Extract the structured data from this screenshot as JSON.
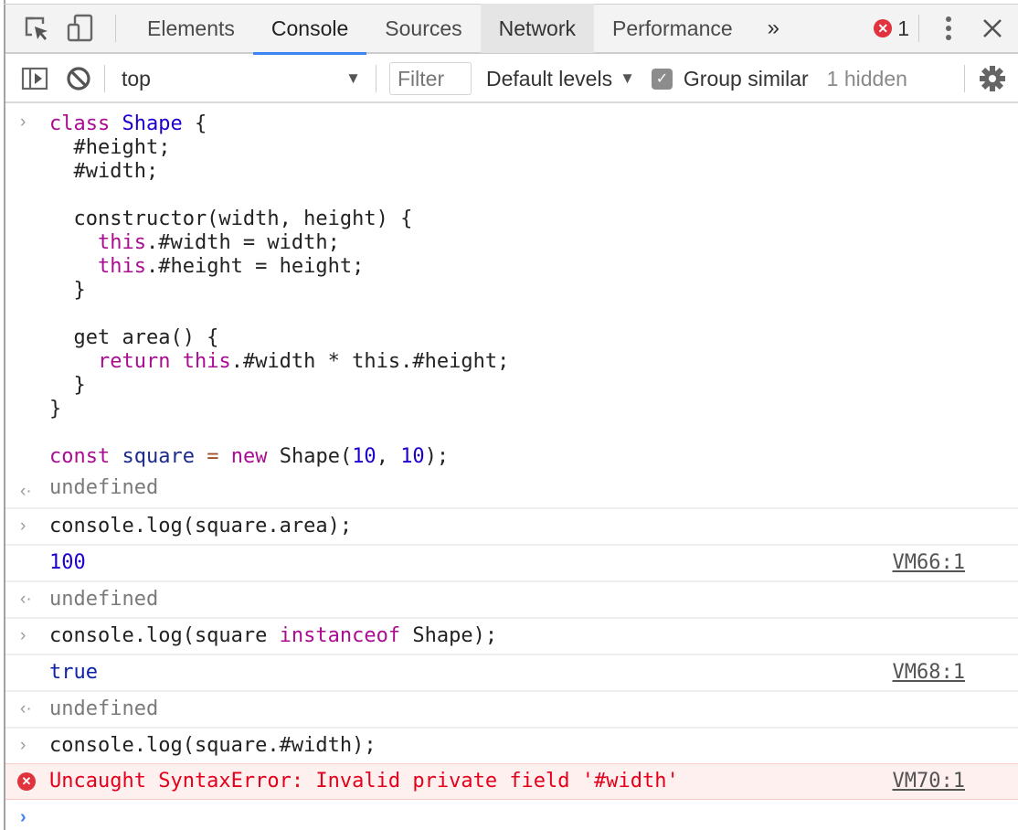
{
  "tabbar": {
    "icons": [
      "inspect-element-icon",
      "device-toolbar-icon"
    ],
    "tabs": [
      {
        "label": "Elements",
        "state": "inactive"
      },
      {
        "label": "Console",
        "state": "active"
      },
      {
        "label": "Sources",
        "state": "inactive"
      },
      {
        "label": "Network",
        "state": "hover"
      },
      {
        "label": "Performance",
        "state": "inactive"
      }
    ],
    "more_tabs": "»",
    "error_count": "1",
    "accent": "#3d84f5",
    "error_color": "#e0333e"
  },
  "toolbar": {
    "context": "top",
    "filter_placeholder": "Filter",
    "levels_label": "Default levels",
    "group_similar_label": "Group similar",
    "group_similar_checked": true,
    "hidden_label": "1 hidden"
  },
  "console": {
    "class_block": {
      "l1_kw": "class",
      "l1_name": "Shape",
      "l1_rest": " {",
      "l2": "  #height;",
      "l3": "  #width;",
      "l5": "  constructor(width, height) {",
      "l6_kw": "this",
      "l6_rest": ".#width = width;",
      "l7_kw": "this",
      "l7_rest": ".#height = height;",
      "l8": "  }",
      "l10": "  get area() {",
      "l11_kw1": "return",
      "l11_kw2": "this",
      "l11_rest": ".#width * this.#height;",
      "l12": "  }",
      "l13": "}",
      "l15_kw": "const",
      "l15_var": "square",
      "l15_op": "=",
      "l15_new": "new",
      "l15_call": " Shape(",
      "l15_n1": "10",
      "l15_sep": ", ",
      "l15_n2": "10",
      "l15_end": ");"
    },
    "result1": "undefined",
    "input2": "console.log(square.area);",
    "log2": "100",
    "log2_source": "VM66:1",
    "result2": "undefined",
    "input3_a": "console.log(square ",
    "input3_kw": "instanceof",
    "input3_b": " Shape);",
    "log3": "true",
    "log3_source": "VM68:1",
    "result3": "undefined",
    "input4": "console.log(square.#width);",
    "error4": "Uncaught SyntaxError: Invalid private field '#width'",
    "error4_source": "VM70:1",
    "glyphs": {
      "input": "›",
      "result": "‹·",
      "prompt": "›",
      "error": "✕"
    }
  }
}
